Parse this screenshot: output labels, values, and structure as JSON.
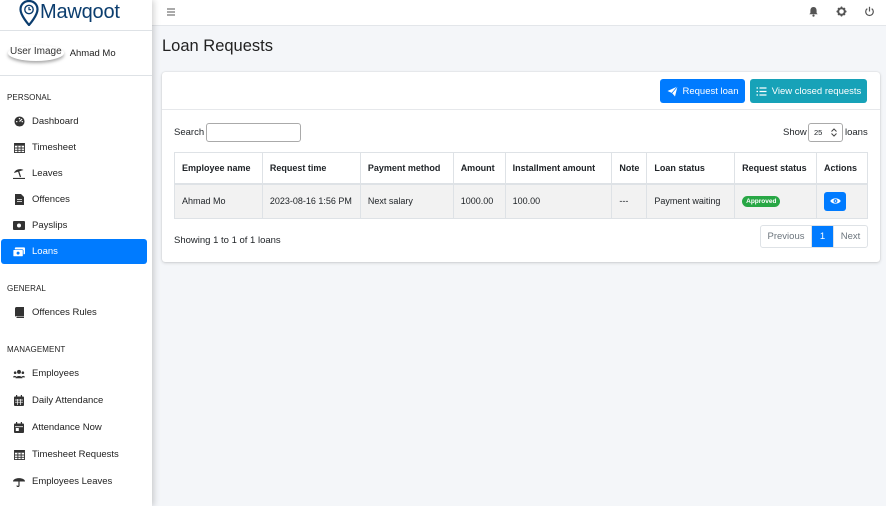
{
  "brand": {
    "name": "Mawqoot",
    "color": "#0b3d6e"
  },
  "user": {
    "image_alt": "User Image",
    "name": "Ahmad Mo"
  },
  "sidebar": {
    "sections": [
      {
        "header": "PERSONAL",
        "items": [
          {
            "label": "Dashboard",
            "icon": "tachometer-icon"
          },
          {
            "label": "Timesheet",
            "icon": "table-icon"
          },
          {
            "label": "Leaves",
            "icon": "umbrella-beach-icon"
          },
          {
            "label": "Offences",
            "icon": "file-icon"
          },
          {
            "label": "Payslips",
            "icon": "money-bill-icon"
          },
          {
            "label": "Loans",
            "icon": "money-bills-icon",
            "active": true
          }
        ]
      },
      {
        "header": "GENERAL",
        "items": [
          {
            "label": "Offences Rules",
            "icon": "book-icon"
          }
        ]
      },
      {
        "header": "MANAGEMENT",
        "items": [
          {
            "label": "Employees",
            "icon": "users-icon"
          },
          {
            "label": "Daily Attendance",
            "icon": "calendar-icon"
          },
          {
            "label": "Attendance Now",
            "icon": "calendar-day-icon"
          },
          {
            "label": "Timesheet Requests",
            "icon": "table-icon"
          },
          {
            "label": "Employees Leaves",
            "icon": "umbrella-icon"
          }
        ]
      }
    ]
  },
  "page": {
    "title": "Loan Requests"
  },
  "actions": {
    "request_loan": "Request loan",
    "view_closed": "View closed requests"
  },
  "filters": {
    "search_label": "Search",
    "search_value": "",
    "show_label": "Show",
    "page_size": "25",
    "loans_label": "loans"
  },
  "table": {
    "columns": [
      "Employee name",
      "Request time",
      "Payment method",
      "Amount",
      "Installment amount",
      "Note",
      "Loan status",
      "Request status",
      "Actions"
    ],
    "rows": [
      {
        "employee": "Ahmad Mo",
        "request_time": "2023-08-16 1:56 PM",
        "payment_method": "Next salary",
        "amount": "1000.00",
        "installment": "100.00",
        "note": "---",
        "loan_status": "Payment waiting",
        "request_status": "Approved"
      }
    ]
  },
  "footer": {
    "showing": "Showing 1 to 1 of 1 loans",
    "previous": "Previous",
    "current_page": "1",
    "next": "Next"
  },
  "colors": {
    "primary": "#007bff",
    "info": "#17a2b8",
    "success": "#28a745",
    "background": "#f4f6f9"
  }
}
